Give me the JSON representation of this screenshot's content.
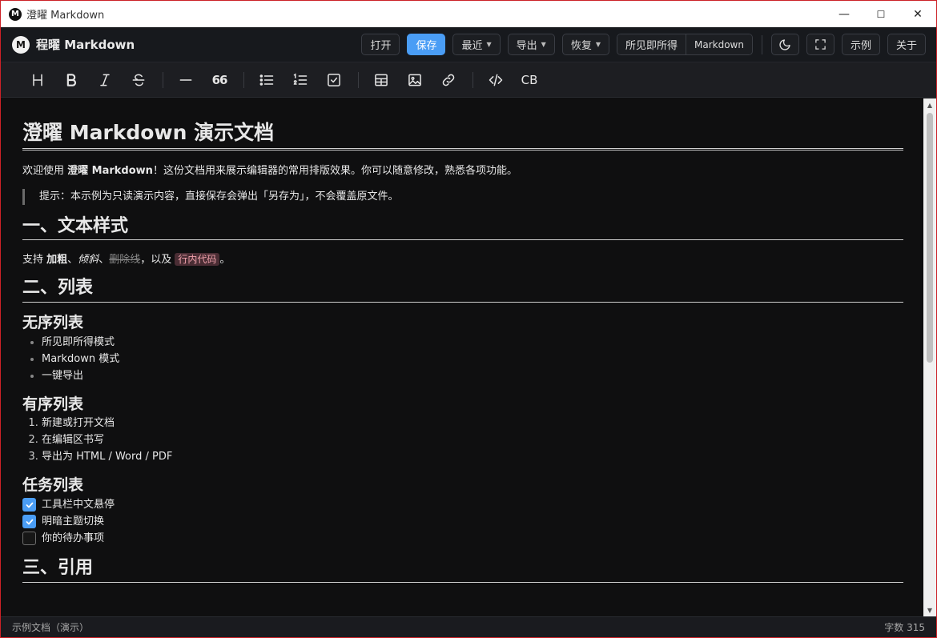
{
  "window": {
    "title": "澄曜 Markdown",
    "logo_letter": "M",
    "minimize": "—",
    "maximize": "☐",
    "close": "✕"
  },
  "appbar": {
    "brand_letter": "M",
    "brand_name": "程曜 Markdown",
    "buttons": {
      "open": "打开",
      "save": "保存",
      "recent": "最近",
      "export": "导出",
      "restore": "恢复",
      "example": "示例",
      "about": "关于"
    },
    "mode": {
      "wysiwyg": "所见即所得",
      "markdown": "Markdown"
    }
  },
  "toolbar": {
    "heading": "H",
    "bold": "B",
    "italic": "I",
    "quote": "66",
    "codeblock": "CB"
  },
  "doc": {
    "title": "澄曜 Markdown 演示文档",
    "intro_pre": "欢迎使用 ",
    "intro_bold": "澄曜 Markdown",
    "intro_post": "！这份文档用来展示编辑器的常用排版效果。你可以随意修改，熟悉各项功能。",
    "tip": "提示：本示例为只读演示内容，直接保存会弹出「另存为」，不会覆盖原文件。",
    "h2_text": "一、文本样式",
    "style_pre": "支持 ",
    "style_bold": "加粗",
    "style_sep1": "、",
    "style_italic": "倾斜",
    "style_sep2": "、",
    "style_strike": "删除线",
    "style_mid": "，以及 ",
    "style_code": "行内代码",
    "style_end": "。",
    "h2_list": "二、列表",
    "h3_unordered": "无序列表",
    "unordered": [
      "所见即所得模式",
      "Markdown 模式",
      "一键导出"
    ],
    "h3_ordered": "有序列表",
    "ordered": [
      "新建或打开文档",
      "在编辑区书写",
      "导出为 HTML / Word / PDF"
    ],
    "h3_tasks": "任务列表",
    "tasks": [
      {
        "label": "工具栏中文悬停",
        "done": true
      },
      {
        "label": "明暗主题切换",
        "done": true
      },
      {
        "label": "你的待办事项",
        "done": false
      }
    ],
    "h2_quote": "三、引用"
  },
  "status": {
    "left": "示例文档（演示）",
    "right": "字数 315"
  },
  "colors": {
    "accent": "#4a9df5",
    "background": "#0f0f10",
    "frame": "#cc2127"
  }
}
